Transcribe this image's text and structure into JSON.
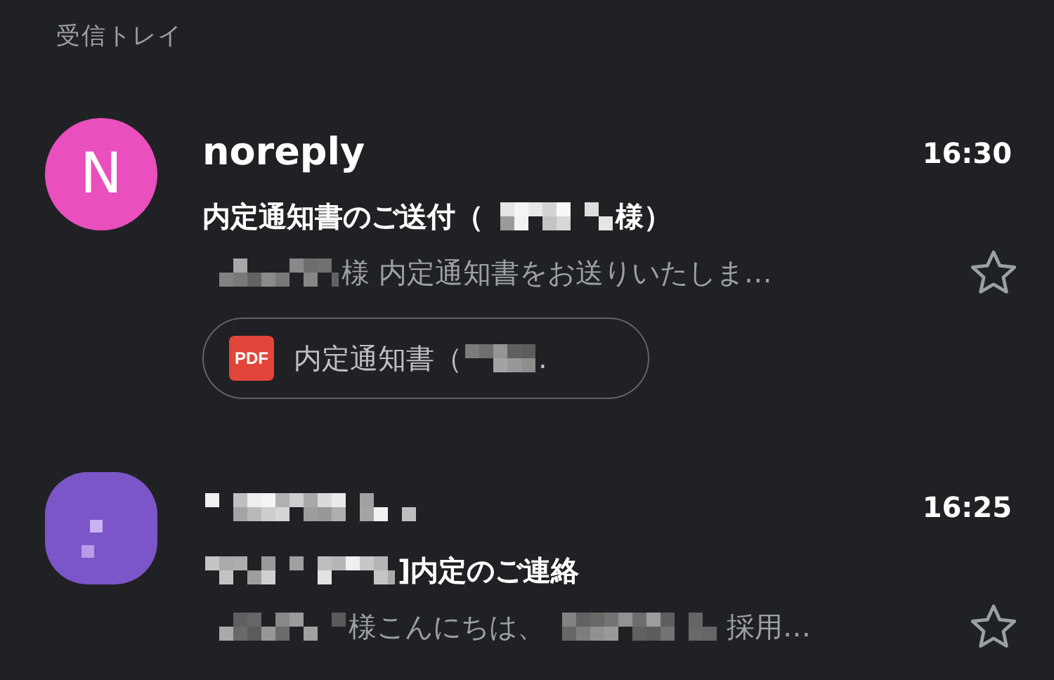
{
  "folder_title": "受信トレイ",
  "messages": [
    {
      "avatar": {
        "kind": "letter",
        "letter": "N",
        "color": "#e94fbd"
      },
      "sender": [
        {
          "kind": "text",
          "text": "noreply"
        }
      ],
      "time": "16:30",
      "subject": [
        {
          "kind": "text",
          "text": "内定通知書のご送付（"
        },
        {
          "kind": "redacted"
        },
        {
          "kind": "text",
          "text": "様）"
        }
      ],
      "snippet": [
        {
          "kind": "redacted"
        },
        {
          "kind": "text",
          "text": "様 内定通知書をお送りいたしま…"
        }
      ],
      "starred": false,
      "attachments": [
        {
          "type": "PDF",
          "name": [
            {
              "kind": "text",
              "text": "内定通知書（"
            },
            {
              "kind": "redacted"
            },
            {
              "kind": "text",
              "text": "."
            }
          ]
        }
      ]
    },
    {
      "avatar": {
        "kind": "redacted",
        "color": "#7c55c8"
      },
      "sender": [
        {
          "kind": "redacted"
        }
      ],
      "time": "16:25",
      "subject": [
        {
          "kind": "redacted"
        },
        {
          "kind": "text",
          "text": "]内定のご連絡"
        }
      ],
      "snippet": [
        {
          "kind": "redacted"
        },
        {
          "kind": "text",
          "text": "様こんにちは、"
        },
        {
          "kind": "redacted"
        },
        {
          "kind": "text",
          "text": "採用…"
        }
      ],
      "starred": false
    }
  ]
}
